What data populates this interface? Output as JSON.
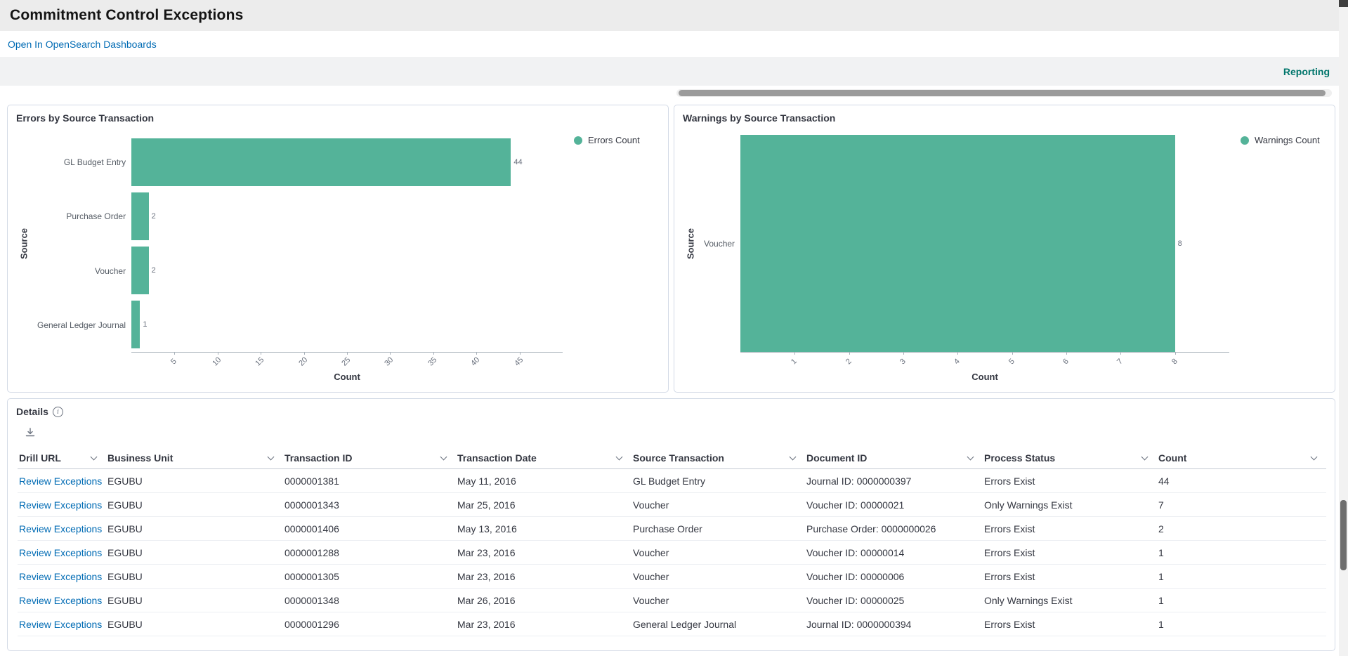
{
  "header": {
    "title": "Commitment Control Exceptions",
    "open_link": "Open In OpenSearch Dashboards",
    "reporting_link": "Reporting"
  },
  "chart_data": [
    {
      "type": "bar",
      "orientation": "horizontal",
      "title": "Errors by Source Transaction",
      "legend": [
        "Errors Count"
      ],
      "legend_position": "right",
      "categories": [
        "GL Budget Entry",
        "Purchase Order",
        "Voucher",
        "General Ledger Journal"
      ],
      "values": [
        44,
        2,
        2,
        1
      ],
      "value_labels": [
        "44",
        "2",
        "2",
        "1"
      ],
      "xlabel": "Count",
      "ylabel": "Source",
      "xticks": [
        5,
        10,
        15,
        20,
        25,
        30,
        35,
        40,
        45
      ],
      "xlim": [
        0,
        50
      ],
      "grid": false,
      "color": "#54B399"
    },
    {
      "type": "bar",
      "orientation": "horizontal",
      "title": "Warnings by Source Transaction",
      "legend": [
        "Warnings Count"
      ],
      "legend_position": "right",
      "categories": [
        "Voucher"
      ],
      "values": [
        8
      ],
      "value_labels": [
        "8"
      ],
      "xlabel": "Count",
      "ylabel": "Source",
      "xticks": [
        1,
        2,
        3,
        4,
        5,
        6,
        7,
        8
      ],
      "xlim": [
        0,
        9
      ],
      "grid": false,
      "color": "#54B399"
    }
  ],
  "details": {
    "title": "Details",
    "info_glyph": "i",
    "columns": [
      "Drill URL",
      "Business Unit",
      "Transaction ID",
      "Transaction Date",
      "Source Transaction",
      "Document ID",
      "Process Status",
      "Count"
    ],
    "rows": [
      [
        "Review Exceptions",
        "EGUBU",
        "0000001381",
        "May 11, 2016",
        "GL Budget Entry",
        "Journal ID: 0000000397",
        "Errors Exist",
        "44"
      ],
      [
        "Review Exceptions",
        "EGUBU",
        "0000001343",
        "Mar 25, 2016",
        "Voucher",
        "Voucher ID: 00000021",
        "Only Warnings Exist",
        "7"
      ],
      [
        "Review Exceptions",
        "EGUBU",
        "0000001406",
        "May 13, 2016",
        "Purchase Order",
        "Purchase Order: 0000000026",
        "Errors Exist",
        "2"
      ],
      [
        "Review Exceptions",
        "EGUBU",
        "0000001288",
        "Mar 23, 2016",
        "Voucher",
        "Voucher ID: 00000014",
        "Errors Exist",
        "1"
      ],
      [
        "Review Exceptions",
        "EGUBU",
        "0000001305",
        "Mar 23, 2016",
        "Voucher",
        "Voucher ID: 00000006",
        "Errors Exist",
        "1"
      ],
      [
        "Review Exceptions",
        "EGUBU",
        "0000001348",
        "Mar 26, 2016",
        "Voucher",
        "Voucher ID: 00000025",
        "Only Warnings Exist",
        "1"
      ],
      [
        "Review Exceptions",
        "EGUBU",
        "0000001296",
        "Mar 23, 2016",
        "General Ledger Journal",
        "Journal ID: 0000000394",
        "Errors Exist",
        "1"
      ]
    ]
  },
  "colors": {
    "bar": "#54B399",
    "link": "#006BB4",
    "reporting": "#00756B"
  }
}
